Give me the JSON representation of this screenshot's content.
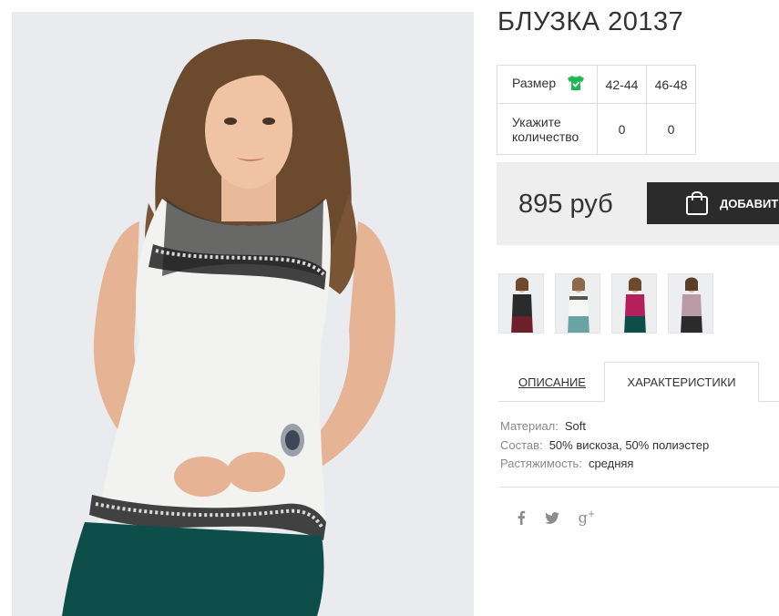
{
  "product": {
    "title": "БЛУЗКА 20137",
    "image_alt": "Model wearing white sleeveless blouse with black lace trim and green trousers"
  },
  "size_table": {
    "size_label": "Размер",
    "size_icon": "shirt-check-icon",
    "sizes": [
      "42-44",
      "46-48"
    ],
    "qty_label_line1": "Укажите",
    "qty_label_line2": "количество",
    "quantities": [
      "0",
      "0"
    ]
  },
  "price": {
    "value": "895 руб",
    "add_button_label": "ДОБАВИТЬ",
    "add_button_icon": "shopping-bag-icon"
  },
  "thumbnails": [
    {
      "name": "thumb-black-blouse",
      "color": "#2b2b2b"
    },
    {
      "name": "thumb-white-blouse",
      "color": "#f2f2f0"
    },
    {
      "name": "thumb-fuchsia-blouse",
      "color": "#b5205c"
    },
    {
      "name": "thumb-mauve-blouse",
      "color": "#b99aa5"
    }
  ],
  "tabs": {
    "description": "ОПИСАНИЕ",
    "characteristics": "ХАРАКТЕРИСТИКИ"
  },
  "specs": [
    {
      "key": "Материал:",
      "value": "Soft"
    },
    {
      "key": "Состав:",
      "value": "50% вискоза, 50% полиэстер"
    },
    {
      "key": "Растяжимость:",
      "value": "средняя"
    }
  ],
  "social": {
    "icons": [
      "facebook-icon",
      "twitter-icon",
      "google-plus-icon"
    ]
  },
  "colors": {
    "accent_dark": "#2b2b2b",
    "price_bg": "#eeeeee",
    "icon_green": "#1db954",
    "muted_text": "#8a8a8a"
  }
}
